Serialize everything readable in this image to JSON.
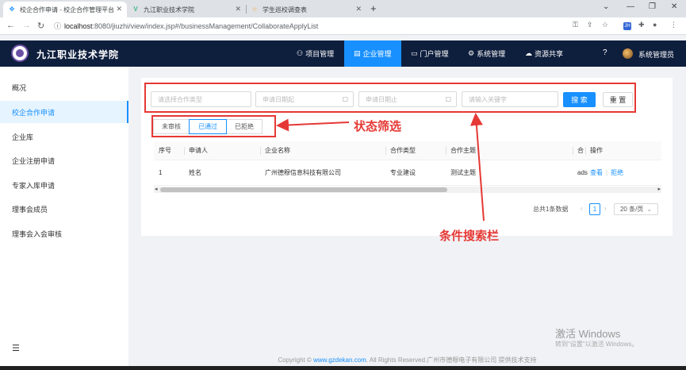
{
  "browser": {
    "tabs": [
      {
        "title": "校企合作申请 - 校企合作管理平台",
        "active": true
      },
      {
        "title": "九江职业技术学院",
        "active": false
      },
      {
        "title": "学生巡校调查表",
        "active": false
      }
    ],
    "url_host": "localhost",
    "url_path": ":8080/jiuzhi/view/index.jsp#/businessManagement/CollaborateApplyList",
    "ext_badge": "JH"
  },
  "header": {
    "brand": "九江职业技术学院",
    "nav": [
      "项目管理",
      "企业管理",
      "门户管理",
      "系统管理",
      "资源共享"
    ],
    "active_nav": "企业管理",
    "admin": "系统管理员",
    "help": "?"
  },
  "sidebar": {
    "items": [
      "概况",
      "校企合作申请",
      "企业库",
      "企业注册申请",
      "专家入库申请",
      "理事会成员",
      "理事会入会审核"
    ],
    "active": "校企合作申请",
    "collapse_icon": "☰"
  },
  "filters": {
    "type_placeholder": "请选择合作类型",
    "start_placeholder": "申请日期起",
    "end_placeholder": "申请日期止",
    "keyword_placeholder": "请输入关键字",
    "search_label": "搜 索",
    "reset_label": "重 置"
  },
  "status_tabs": {
    "items": [
      "未审核",
      "已通过",
      "已拒绝"
    ],
    "active": "已通过"
  },
  "table": {
    "columns": [
      "序号",
      "申请人",
      "企业名称",
      "合作类型",
      "合作主题",
      "合",
      "操作"
    ],
    "rows": [
      {
        "index": "1",
        "applicant": "姓名",
        "company": "广州德穆信息科技有限公司",
        "type": "专业建设",
        "theme": "测试主题",
        "extra": "ads",
        "view": "查看",
        "reject": "拒绝"
      }
    ]
  },
  "pagination": {
    "total": "总共1条数据",
    "prev": "‹",
    "current": "1",
    "next": "›",
    "page_size": "20 条/页"
  },
  "annotations": {
    "status_filter": "状态筛选",
    "search_bar": "条件搜索栏"
  },
  "footer": {
    "copyright": "Copyright ©",
    "link": "www.gzdekan.com",
    "rest": ". All Rights Reserved.广州市德穆电子有限公司 提供技术支持"
  },
  "watermark": {
    "line1": "激活 Windows",
    "line2": "转到\"设置\"以激活 Windows。"
  },
  "colors": {
    "primary": "#1890ff",
    "header_bg": "#0e1e3d",
    "annotation": "#e53935"
  }
}
